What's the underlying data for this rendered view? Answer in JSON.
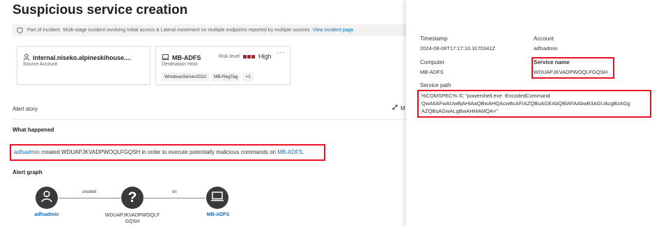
{
  "alert": {
    "title": "Suspicious service creation",
    "incident": {
      "label": "Part of incident:",
      "description": "Multi-stage incident involving Initial access & Lateral movement on multiple endpoints reported by multiple sources",
      "link": "View incident page"
    },
    "source_card": {
      "name": "internal.niseko.alpineskihouse....",
      "subtitle": "Source Account"
    },
    "dest_card": {
      "name": "MB-ADFS",
      "subtitle": "Destination Host",
      "risk_label": "Risk level",
      "risk_value": "High",
      "more": "···",
      "tags": [
        "WindowsServer2022",
        "MB-RegTag",
        "+1"
      ]
    },
    "story_label": "Alert story",
    "expand_label": "M",
    "what_happened_label": "What happened",
    "sentence": {
      "actor": "adfsadmin",
      "middle": " created WDUAPJKVADPWOQLFGQSH in order to execute potentially malicious commands on ",
      "target": "MB-ADFS",
      "end": "."
    },
    "graph_label": "Alert graph",
    "graph": {
      "nodes": [
        "adfsadmin",
        "WDUAPJKVADPWOQLF",
        "GQSH",
        "MB-ADFS"
      ],
      "edges": [
        "created",
        "on"
      ]
    }
  },
  "details": {
    "timestamp_label": "Timestamp",
    "timestamp_value": "2024-08-06T17:17:10.3170341Z",
    "account_label": "Account",
    "account_value": "adfsadmin",
    "computer_label": "Computer",
    "computer_value": "MB-ADFS",
    "service_name_label": "Service name",
    "service_name_value": "WDUAPJKVADPWOQLFGQSH",
    "service_path_label": "Service path",
    "service_path_lines": [
      "%COMSPEC% /C \"powershell.exe -EncodedCommand",
      "QwA6AFwAUwBjAHIAaQBwAHQAcwBcAFIAZQBuAGEAbQBlAFAAbwB3AGUAcgBzAGg",
      "AZQBsAGwALgBwAHMAMQA=\""
    ]
  },
  "colors": {
    "link": "#0f6cbd",
    "highlight": "#e81123",
    "risk_high": "#a4262c",
    "node": "#3b3a39"
  },
  "icons": [
    "shield-icon",
    "person-icon",
    "laptop-icon",
    "expand-icon",
    "question-icon"
  ]
}
